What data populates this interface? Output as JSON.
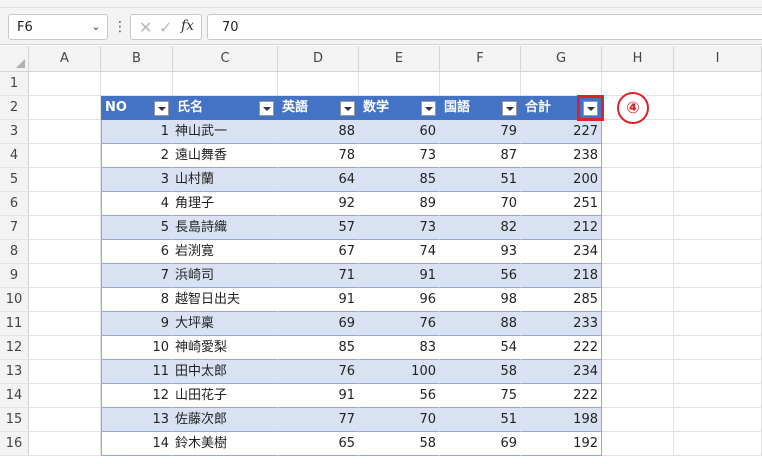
{
  "formula_bar": {
    "name_box": "F6",
    "formula": "70",
    "fx_label": "fx"
  },
  "columns": [
    "A",
    "B",
    "C",
    "D",
    "E",
    "F",
    "G",
    "H",
    "I"
  ],
  "rows": [
    "1",
    "2",
    "3",
    "4",
    "5",
    "6",
    "7",
    "8",
    "9",
    "10",
    "11",
    "12",
    "13",
    "14",
    "15",
    "16"
  ],
  "table": {
    "headers": [
      "NO",
      "氏名",
      "英語",
      "数学",
      "国語",
      "合計"
    ],
    "records": [
      {
        "no": "1",
        "name": "神山武一",
        "en": "88",
        "math": "60",
        "jp": "79",
        "total": "227"
      },
      {
        "no": "2",
        "name": "遠山舞香",
        "en": "78",
        "math": "73",
        "jp": "87",
        "total": "238"
      },
      {
        "no": "3",
        "name": "山村蘭",
        "en": "64",
        "math": "85",
        "jp": "51",
        "total": "200"
      },
      {
        "no": "4",
        "name": "角理子",
        "en": "92",
        "math": "89",
        "jp": "70",
        "total": "251"
      },
      {
        "no": "5",
        "name": "長島詩織",
        "en": "57",
        "math": "73",
        "jp": "82",
        "total": "212"
      },
      {
        "no": "6",
        "name": "岩渕寛",
        "en": "67",
        "math": "74",
        "jp": "93",
        "total": "234"
      },
      {
        "no": "7",
        "name": "浜崎司",
        "en": "71",
        "math": "91",
        "jp": "56",
        "total": "218"
      },
      {
        "no": "8",
        "name": "越智日出夫",
        "en": "91",
        "math": "96",
        "jp": "98",
        "total": "285"
      },
      {
        "no": "9",
        "name": "大坪稟",
        "en": "69",
        "math": "76",
        "jp": "88",
        "total": "233"
      },
      {
        "no": "10",
        "name": "神崎愛梨",
        "en": "85",
        "math": "83",
        "jp": "54",
        "total": "222"
      },
      {
        "no": "11",
        "name": "田中太郎",
        "en": "76",
        "math": "100",
        "jp": "58",
        "total": "234"
      },
      {
        "no": "12",
        "name": "山田花子",
        "en": "91",
        "math": "56",
        "jp": "75",
        "total": "222"
      },
      {
        "no": "13",
        "name": "佐藤次郎",
        "en": "77",
        "math": "70",
        "jp": "51",
        "total": "198"
      },
      {
        "no": "14",
        "name": "鈴木美樹",
        "en": "65",
        "math": "58",
        "jp": "69",
        "total": "192"
      }
    ]
  },
  "annotation": {
    "marker_label": "④"
  },
  "colors": {
    "table_header": "#4472c4",
    "band_row": "#d9e1f2",
    "highlight": "#e0202a"
  }
}
